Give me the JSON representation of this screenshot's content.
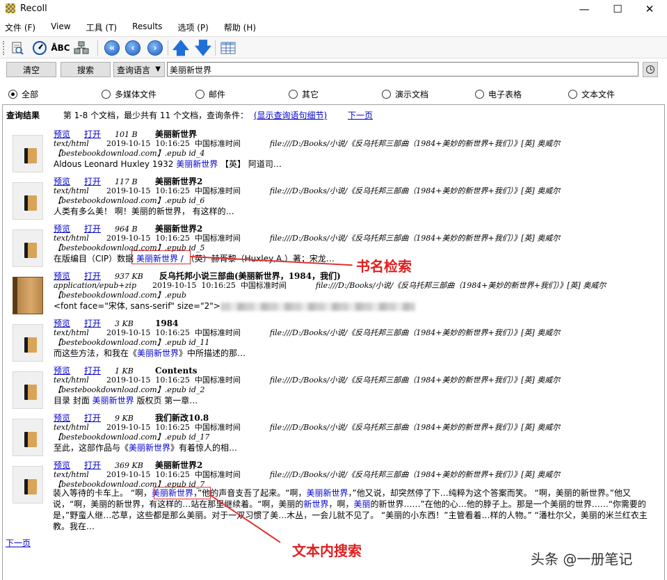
{
  "window": {
    "title": "Recoll",
    "minimize": "—",
    "maximize": "☐",
    "close": "✕"
  },
  "menu": [
    "文件 (F)",
    "View",
    "工具 (T)",
    "Results",
    "选项 (P)",
    "帮助 (H)"
  ],
  "toolbar": {
    "icons": [
      "history-icon",
      "speed-icon",
      "spelling-icon",
      "index-icon",
      "first-page-icon",
      "prev-page-icon",
      "next-page-icon",
      "sort-up-icon",
      "sort-down-icon",
      "table-view-icon"
    ],
    "spell_label": "ÅBC"
  },
  "search": {
    "clear_label": "清空",
    "search_label": "搜索",
    "mode_label": "查询语言",
    "query": "美丽新世界"
  },
  "filters": [
    {
      "label": "全部",
      "selected": true
    },
    {
      "label": "多媒体文件",
      "selected": false
    },
    {
      "label": "邮件",
      "selected": false
    },
    {
      "label": "其它",
      "selected": false
    },
    {
      "label": "演示文档",
      "selected": false
    },
    {
      "label": "电子表格",
      "selected": false
    },
    {
      "label": "文本文件",
      "selected": false
    }
  ],
  "results_header": {
    "label": "查询结果",
    "summary": "第 1-8 个文档，最少共有 11 个文档，查询条件：",
    "details_link": "(显示查询语句细节)",
    "next_link": "下一页"
  },
  "result_common": {
    "preview": "预览",
    "open": "打开",
    "date": "2019-10-15",
    "time": "10:16:25",
    "tz": "中国标准时间",
    "path": "file:///D:/Books/小说/《反乌托邦三部曲（1984+美妙的新世界+我们）》[英] 奥威尔",
    "source": "【bestebookdownload.com】.epub"
  },
  "results": [
    {
      "size": "101 B",
      "title": "美丽新世界",
      "mime": "text/html",
      "id": "id_4",
      "snip_pre": "Aldous Leonard Huxley 1932 ",
      "snip_hl": "美丽新世界",
      "snip_post": " 【英】 阿道司…"
    },
    {
      "size": "117 B",
      "title": "美丽新世界2",
      "mime": "text/html",
      "id": "id_6",
      "snip_pre": "人类有多么美！ 啊！美丽的新世界， 有这样的…",
      "snip_hl": "",
      "snip_post": ""
    },
    {
      "size": "964 B",
      "title": "美丽新世界2",
      "mime": "text/html",
      "id": "id_5",
      "snip_pre": "在版编目（CIP）数据 ",
      "snip_hl": "美丽新世界 /",
      "snip_post": " （英）赫胥黎（Huxley,A.）著；宋龙…"
    },
    {
      "size": "937 KB",
      "title": "反乌托邦小说三部曲(美丽新世界，1984，我们)",
      "mime": "application/epub+zip",
      "id": "",
      "snip_pre": "<font face=\"宋体, sans-serif\" size=\"2\">",
      "snip_hl": "",
      "snip_post": ""
    },
    {
      "size": "3 KB",
      "title": "1984",
      "mime": "text/html",
      "id": "id_11",
      "snip_pre": "而这些方法，和我在《",
      "snip_hl": "美丽新世界",
      "snip_post": "》中所描述的那…"
    },
    {
      "size": "1 KB",
      "title": "Contents",
      "mime": "text/html",
      "id": "id_2",
      "snip_pre": "目录 封面 ",
      "snip_hl": "美丽新世界",
      "snip_post": " 版权页 第一章…"
    },
    {
      "size": "9 KB",
      "title": "我们新改10.8",
      "mime": "text/html",
      "id": "id_17",
      "snip_pre": "至此，这部作品与《",
      "snip_hl": "美丽新世界",
      "snip_post": "》有着惊人的相…"
    },
    {
      "size": "369 KB",
      "title": "美丽新世界2",
      "mime": "text/html",
      "id": "id_7",
      "snip_pre": "",
      "snip_hl": "",
      "snip_post": ""
    }
  ],
  "long_snippet": {
    "p1": "装入等待的卡车上。 “啊，",
    "h1": "美丽新世界",
    "p2": "，”他的声音支吾了起来。“啊，",
    "h2": "美丽新世界",
    "p3": "，”他又说，却突然停了下…纯粹为这个答案而笑。 “啊，美丽的新世界。”他又说，“啊，美丽的新世界，有这样的…站在那里继续着。“啊，美丽的",
    "h3": "新世界",
    "p4": "，啊，",
    "h4": "美丽",
    "p5": "的新世界……”在他的心…他的脖子上。那是一个美丽的世界……“你需要的是，”野蛮人继…芯草，这些都是那么美丽。对于一双习惯了美…木丛，一会儿就不见了。 “美丽的小东西！”主管看着…样的人物。” “潘杜尔父，美丽的米兰红衣主教。我在…"
  },
  "bottom_next": "下一页",
  "annotations": {
    "title_search": "书名检索",
    "text_search": "文本内搜索"
  },
  "watermark": "头条 @一册笔记"
}
